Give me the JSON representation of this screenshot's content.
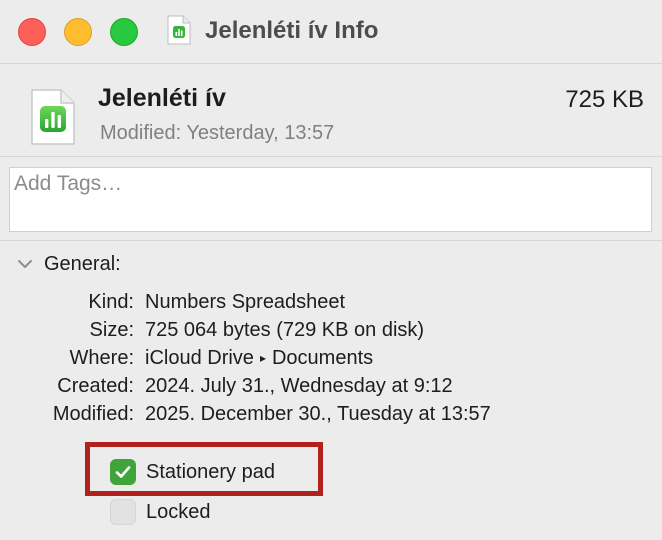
{
  "window": {
    "title": "Jelenléti ív Info"
  },
  "file": {
    "name": "Jelenléti ív",
    "size": "725 KB",
    "modified_label": "Modified:",
    "modified_value": "Yesterday, 13:57"
  },
  "tags": {
    "placeholder": "Add Tags…"
  },
  "general": {
    "header": "General:",
    "rows": [
      {
        "key": "Kind:",
        "value": "Numbers Spreadsheet"
      },
      {
        "key": "Size:",
        "value": "725 064 bytes (729 KB on disk)"
      },
      {
        "key": "Where:",
        "value_parts": [
          "iCloud Drive",
          "▸",
          "Documents"
        ]
      },
      {
        "key": "Created:",
        "value": "2024. July 31., Wednesday at 9:12"
      },
      {
        "key": "Modified:",
        "value": "2025. December 30., Tuesday at 13:57"
      }
    ]
  },
  "options": {
    "stationery_pad": {
      "label": "Stationery pad",
      "checked": true
    },
    "locked": {
      "label": "Locked",
      "checked": false
    }
  },
  "icons": {
    "document": "numbers-document-icon",
    "disclosure": "chevron-down-icon",
    "check": "checkmark-icon"
  },
  "colors": {
    "accent_green": "#3fa53a",
    "highlight_red": "#b1211d",
    "close": "#fe5f57",
    "minimize": "#febc2e",
    "zoom": "#28c840"
  }
}
